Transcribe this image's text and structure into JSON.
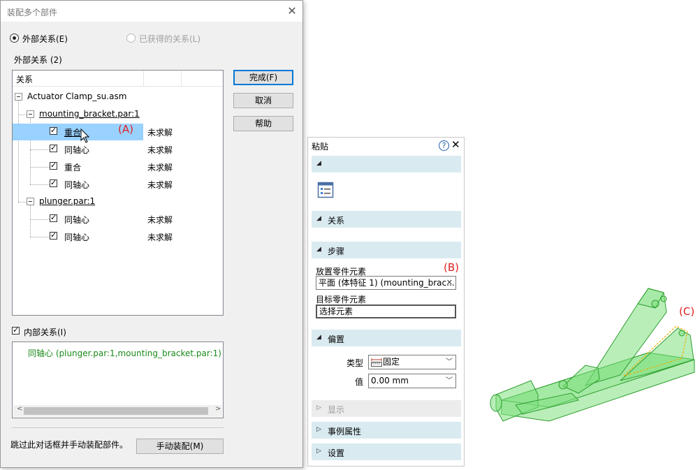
{
  "dialog": {
    "title": "装配多个部件",
    "close_glyph": "✕",
    "radio_external": "外部关系(E)",
    "radio_obtained": "已获得的关系(L)",
    "section_label": "外部关系 (2)",
    "buttons": {
      "finish": "完成(F)",
      "cancel": "取消",
      "help": "帮助",
      "manual": "手动装配(M)"
    },
    "tree_header": "关系",
    "tree": {
      "root": "Actuator Clamp_su.asm",
      "group1": {
        "name": "mounting_bracket.par:1",
        "items": [
          {
            "label": "重合",
            "status": "未求解"
          },
          {
            "label": "同轴心",
            "status": "未求解"
          },
          {
            "label": "重合",
            "status": "未求解"
          },
          {
            "label": "同轴心",
            "status": "未求解"
          }
        ]
      },
      "group2": {
        "name": "plunger.par:1",
        "items": [
          {
            "label": "同轴心",
            "status": "未求解"
          },
          {
            "label": "同轴心",
            "status": "未求解"
          }
        ]
      }
    },
    "internal_label": "内部关系(I)",
    "internal_item": "同轴心 (plunger.par:1,mounting_bracket.par:1)",
    "footer_text": "跳过此对话框并手动装配部件。"
  },
  "panel": {
    "title": "粘贴",
    "help_glyph": "?",
    "close_glyph": "✕",
    "sections": {
      "relations": "关系",
      "steps": "步骤",
      "offset": "偏置",
      "display": "显示",
      "instance": "事例属性",
      "settings": "设置"
    },
    "place_label": "放置零件元素",
    "place_value": "平面 (体特征 1) (mounting_brac...",
    "clear_glyph": "✕",
    "target_label": "目标零件元素",
    "target_value": "选择元素",
    "type_label": "类型",
    "type_value": "固定",
    "value_label": "值",
    "value_value": "0.00 mm"
  },
  "annotations": {
    "a": "(A)",
    "b": "(B)",
    "c": "(C)"
  },
  "colors": {
    "selection": "#99d1ff",
    "section_bg": "#d9ebf1",
    "model_green": "#66dd66",
    "annotation_red": "#e02020",
    "internal_text": "#1a8a1a"
  }
}
